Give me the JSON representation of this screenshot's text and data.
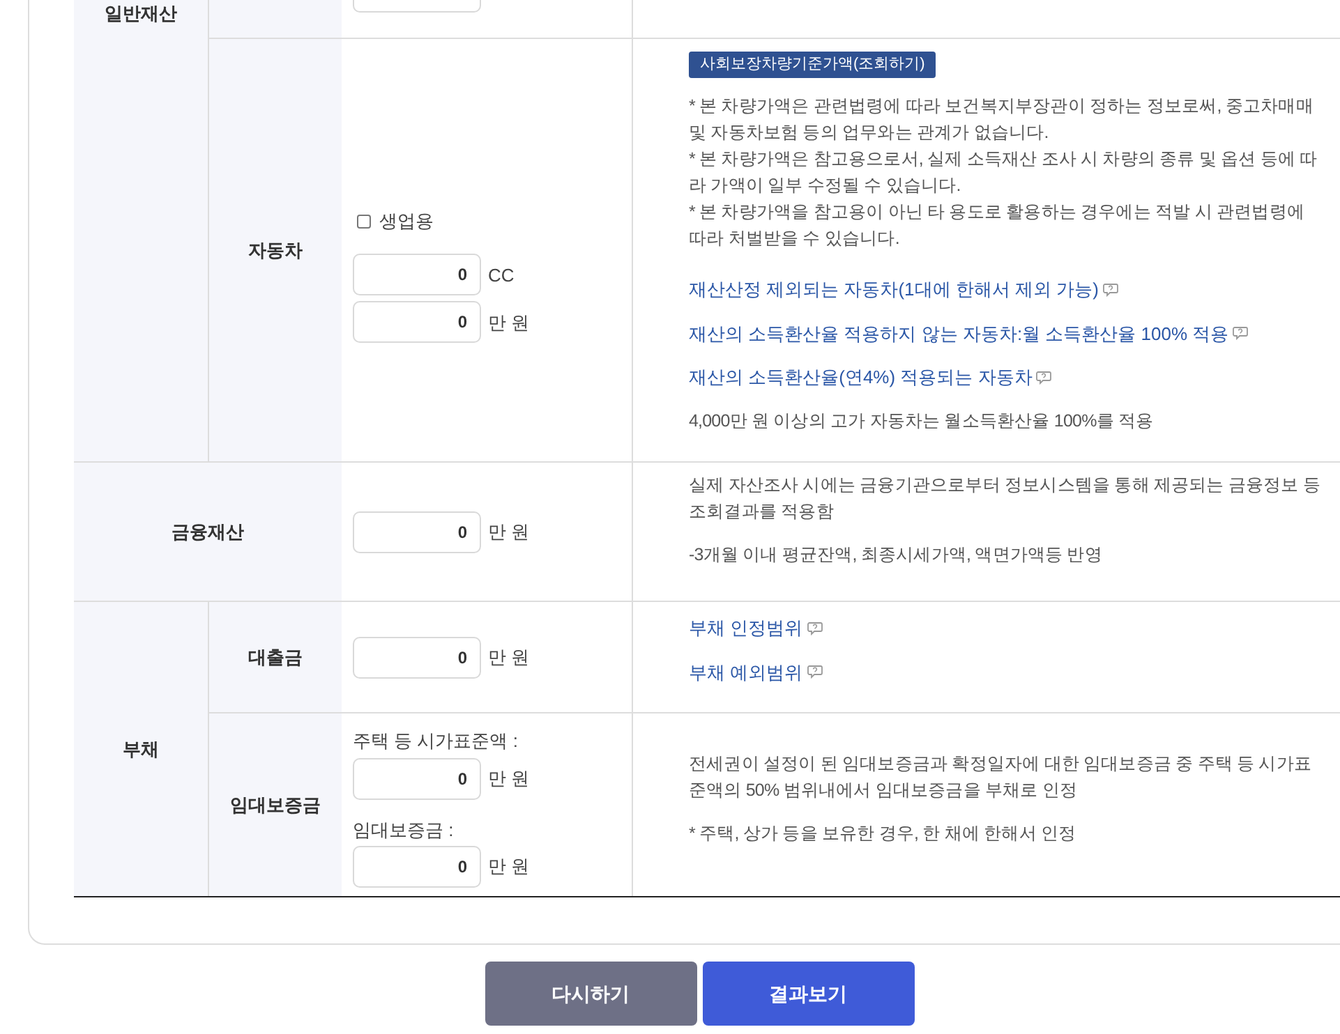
{
  "general_property": {
    "label": "일반재산"
  },
  "car": {
    "label": "자동차",
    "checkbox": {
      "label": "생업용",
      "checked": false
    },
    "fields": [
      {
        "value": "0",
        "unit": "CC"
      },
      {
        "value": "0",
        "unit": "만 원"
      }
    ],
    "badge": "사회보장차량기준가액(조회하기)",
    "notes": [
      "* 본 차량가액은 관련법령에 따라 보건복지부장관이 정하는 정보로써, 중고차매매 및 자동차보험 등의 업무와는 관계가 없습니다.",
      "* 본 차량가액은 참고용으로서, 실제 소득재산 조사 시 차량의 종류 및 옵션 등에 따라 가액이 일부 수정될 수 있습니다.",
      "* 본 차량가액을 참고용이 아닌 타 용도로 활용하는 경우에는 적발 시 관련법령에 따라 처벌받을 수 있습니다."
    ],
    "links": [
      "재산산정 제외되는 자동차(1대에 한해서 제외 가능)",
      "재산의 소득환산율 적용하지 않는 자동차:월 소득환산율 100% 적용",
      "재산의 소득환산율(연4%) 적용되는 자동차"
    ],
    "footnote": "4,000만 원 이상의 고가 자동차는 월소득환산율 100%를 적용"
  },
  "financial": {
    "label": "금융재산",
    "field": {
      "value": "0",
      "unit": "만 원"
    },
    "notes": [
      "실제 자산조사 시에는 금융기관으로부터 정보시스템을 통해 제공되는 금융정보 등 조회결과를 적용함",
      "-3개월 이내 평균잔액, 최종시세가액, 액면가액등 반영"
    ]
  },
  "debt": {
    "label": "부채",
    "loan": {
      "label": "대출금",
      "field": {
        "value": "0",
        "unit": "만 원"
      },
      "links": [
        "부채 인정범위",
        "부채 예외범위"
      ]
    },
    "deposit": {
      "label": "임대보증금",
      "fields": [
        {
          "caption": "주택 등 시가표준액 :",
          "value": "0",
          "unit": "만 원"
        },
        {
          "caption": "임대보증금 :",
          "value": "0",
          "unit": "만 원"
        }
      ],
      "notes": [
        "전세권이 설정이 된 임대보증금과 확정일자에 대한 임대보증금 중 주택 등 시가표준액의 50% 범위내에서 임대보증금을 부채로 인정",
        "* 주택, 상가 등을 보유한 경우, 한 채에 한해서 인정"
      ]
    }
  },
  "buttons": [
    {
      "label": "다시하기",
      "kind": "reset"
    },
    {
      "label": "결과보기",
      "kind": "submit"
    }
  ]
}
